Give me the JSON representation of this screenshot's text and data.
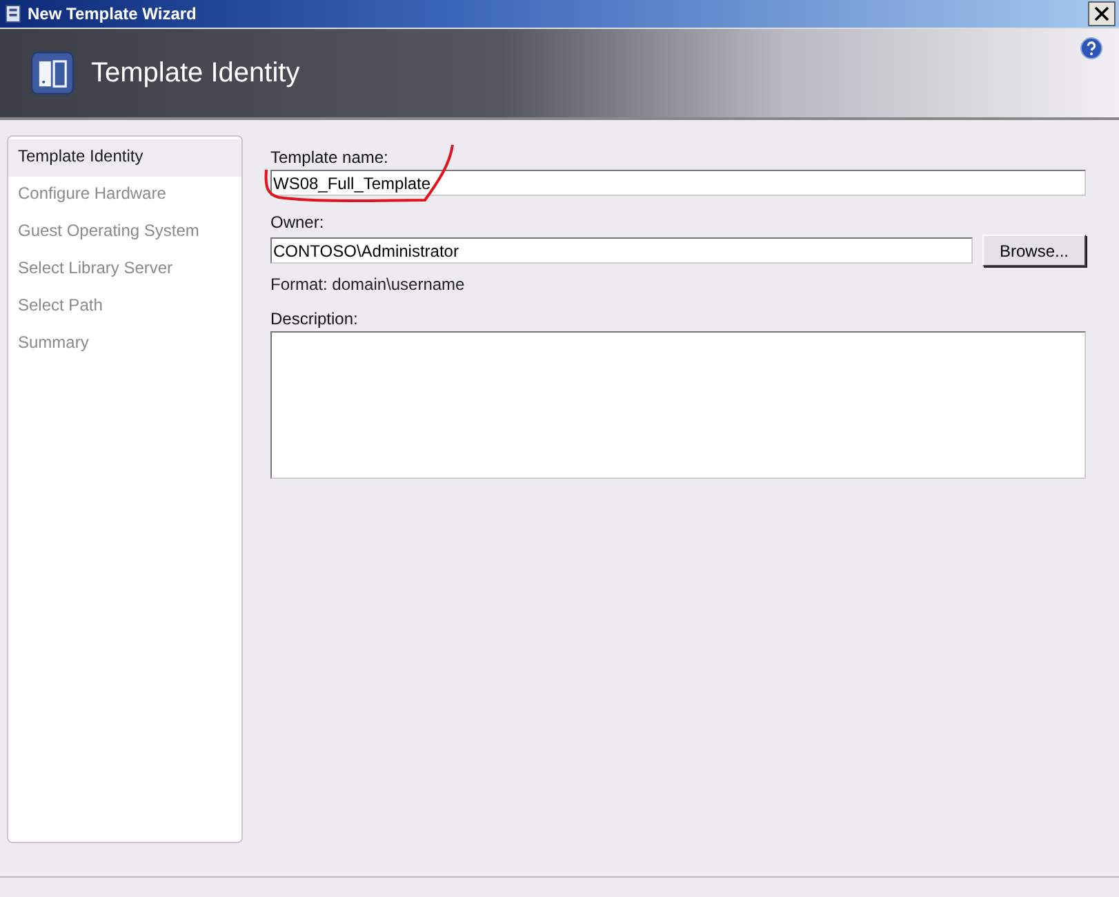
{
  "window": {
    "title": "New Template Wizard"
  },
  "header": {
    "title": "Template Identity"
  },
  "steps": [
    {
      "label": "Template Identity",
      "selected": true
    },
    {
      "label": "Configure Hardware",
      "selected": false
    },
    {
      "label": "Guest Operating System",
      "selected": false
    },
    {
      "label": "Select Library Server",
      "selected": false
    },
    {
      "label": "Select Path",
      "selected": false
    },
    {
      "label": "Summary",
      "selected": false
    }
  ],
  "form": {
    "name_label": "Template name:",
    "name_value": "WS08_Full_Template",
    "owner_label": "Owner:",
    "owner_value": "CONTOSO\\Administrator",
    "browse_button": "Browse...",
    "format_hint": "Format: domain\\username",
    "description_label": "Description:"
  }
}
